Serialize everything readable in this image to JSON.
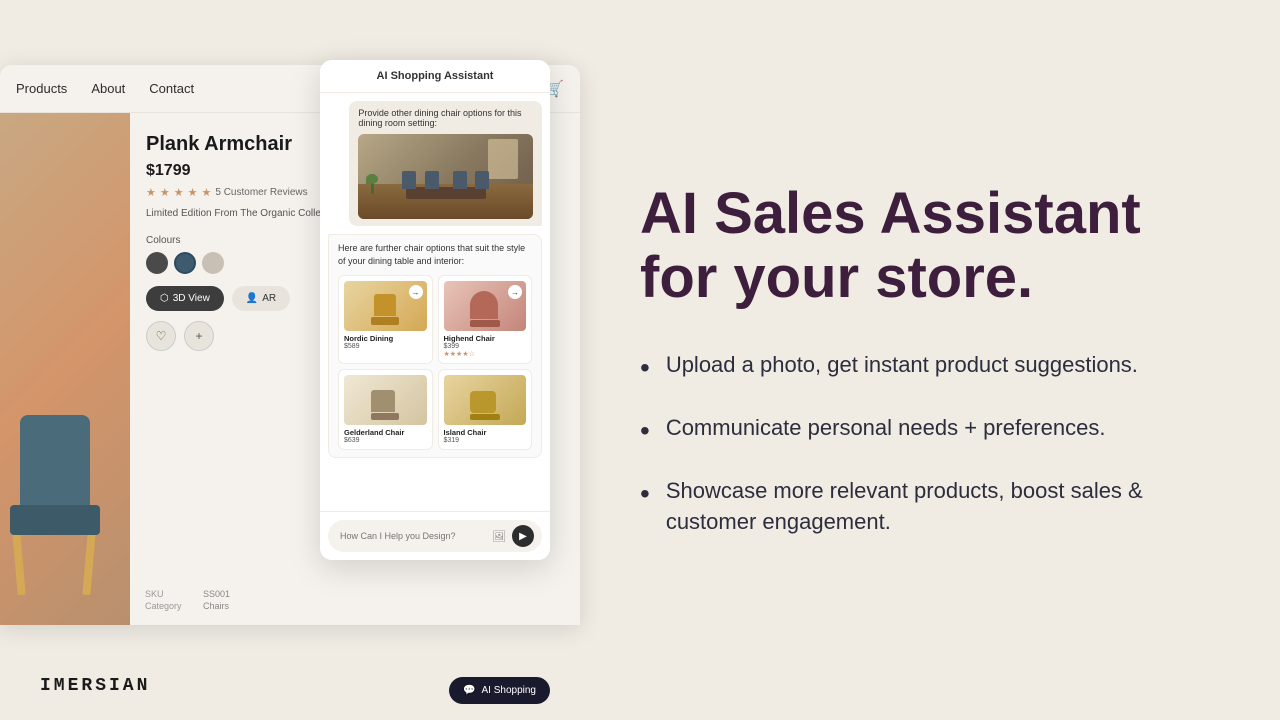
{
  "nav": {
    "links": [
      "Products",
      "About",
      "Contact"
    ],
    "icons": [
      "search",
      "heart",
      "cart"
    ]
  },
  "product": {
    "name": "Plank Armchair",
    "price": "$1799",
    "reviews_count": "5 Customer Reviews",
    "description": "Limited Edition From The Organic Collection Don't miss your chance of history.",
    "colours_label": "Colours",
    "sku_label": "SKU",
    "sku_value": "SS001",
    "category_label": "Category",
    "category_value": "Chairs",
    "btn_3d": "3D View",
    "btn_ar": "AR"
  },
  "ai_chat": {
    "header": "AI Shopping Assistant",
    "user_message": "Provide other dining chair options for this dining room setting:",
    "ai_response_text": "Here are further chair options that suit the style of your dining table and interior:",
    "input_placeholder": "How Can I Help you Design?",
    "products": [
      {
        "name": "Nordic Dining",
        "price": "$589",
        "has_stars": false
      },
      {
        "name": "Highend Chair",
        "price": "$399",
        "has_stars": true,
        "stars": "★★★★☆"
      },
      {
        "name": "Gelderland Chair",
        "price": "$639",
        "has_stars": false
      },
      {
        "name": "Island Chair",
        "price": "$319",
        "has_stars": false
      }
    ],
    "shopping_btn": "AI Shopping"
  },
  "hero": {
    "headline_line1": "AI Sales Assistant",
    "headline_line2": "for your store.",
    "bullets": [
      "Upload a photo, get instant product suggestions.",
      "Communicate personal needs + preferences.",
      "Showcase more relevant products, boost sales & customer engagement."
    ]
  },
  "logo": {
    "text": "IMERSIAN"
  }
}
